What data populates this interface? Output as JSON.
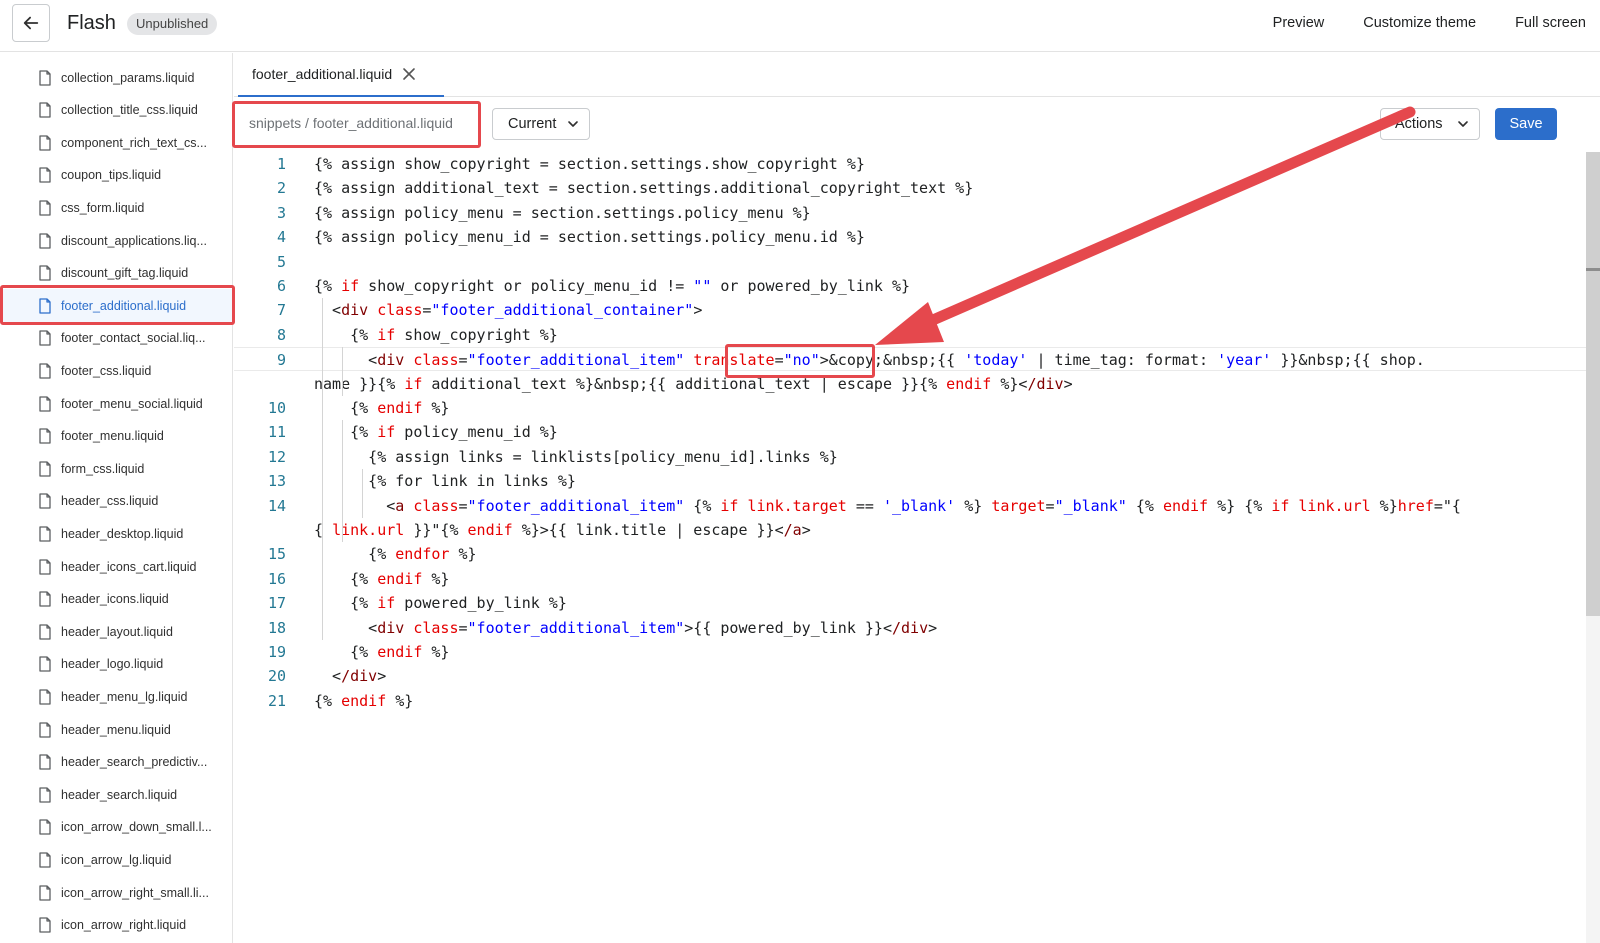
{
  "header": {
    "title": "Flash",
    "status": "Unpublished",
    "actions": [
      "Preview",
      "Customize theme",
      "Full screen"
    ]
  },
  "sidebar": {
    "files": [
      "collection_params.liquid",
      "collection_title_css.liquid",
      "component_rich_text_cs...",
      "coupon_tips.liquid",
      "css_form.liquid",
      "discount_applications.liq...",
      "discount_gift_tag.liquid",
      "footer_additional.liquid",
      "footer_contact_social.liq...",
      "footer_css.liquid",
      "footer_menu_social.liquid",
      "footer_menu.liquid",
      "form_css.liquid",
      "header_css.liquid",
      "header_desktop.liquid",
      "header_icons_cart.liquid",
      "header_icons.liquid",
      "header_layout.liquid",
      "header_logo.liquid",
      "header_menu_lg.liquid",
      "header_menu.liquid",
      "header_search_predictiv...",
      "header_search.liquid",
      "icon_arrow_down_small.l...",
      "icon_arrow_lg.liquid",
      "icon_arrow_right_small.li...",
      "icon_arrow_right.liquid"
    ],
    "active_index": 7
  },
  "tabs": [
    {
      "label": "footer_additional.liquid"
    }
  ],
  "toolbar": {
    "breadcrumb": "snippets / footer_additional.liquid",
    "version": "Current",
    "actions_label": "Actions",
    "save_label": "Save"
  },
  "editor": {
    "lines": [
      {
        "n": "1",
        "code": "{% assign show_copyright = section.settings.show_copyright %}"
      },
      {
        "n": "2",
        "code": "{% assign additional_text = section.settings.additional_copyright_text %}"
      },
      {
        "n": "3",
        "code": "{% assign policy_menu = section.settings.policy_menu %}"
      },
      {
        "n": "4",
        "code": "{% assign policy_menu_id = section.settings.policy_menu.id %}"
      },
      {
        "n": "5",
        "code": ""
      },
      {
        "n": "6",
        "code": "{% if show_copyright or policy_menu_id != \"\" or powered_by_link %}"
      },
      {
        "n": "7",
        "code": "  <div class=\"footer_additional_container\">"
      },
      {
        "n": "8",
        "code": "    {% if show_copyright %}"
      },
      {
        "n": "9",
        "code": "      <div class=\"footer_additional_item\" translate=\"no\">&copy;&nbsp;{{ 'today' | time_tag: format: 'year' }}&nbsp;{{ shop."
      },
      {
        "n": "",
        "code": "name }}{% if additional_text %}&nbsp;{{ additional_text | escape }}{% endif %}</div>"
      },
      {
        "n": "10",
        "code": "    {% endif %}"
      },
      {
        "n": "11",
        "code": "    {% if policy_menu_id %}"
      },
      {
        "n": "12",
        "code": "      {% assign links = linklists[policy_menu_id].links %}"
      },
      {
        "n": "13",
        "code": "      {% for link in links %}"
      },
      {
        "n": "14",
        "code": "        <a class=\"footer_additional_item\" {% if link.target == '_blank' %} target=\"_blank\" {% endif %} {% if link.url %}href=\"{"
      },
      {
        "n": "",
        "code": "{ link.url }}\"{% endif %}>{{ link.title | escape }}</a>"
      },
      {
        "n": "15",
        "code": "      {% endfor %}"
      },
      {
        "n": "16",
        "code": "    {% endif %}"
      },
      {
        "n": "17",
        "code": "    {% if powered_by_link %}"
      },
      {
        "n": "18",
        "code": "      <div class=\"footer_additional_item\">{{ powered_by_link }}</div>"
      },
      {
        "n": "19",
        "code": "    {% endif %}"
      },
      {
        "n": "20",
        "code": "  </div>"
      },
      {
        "n": "21",
        "code": "{% endif %}"
      }
    ]
  },
  "colors": {
    "accent": "#2c6ecb",
    "annotation": "#e5484d",
    "line_number": "#237893"
  }
}
